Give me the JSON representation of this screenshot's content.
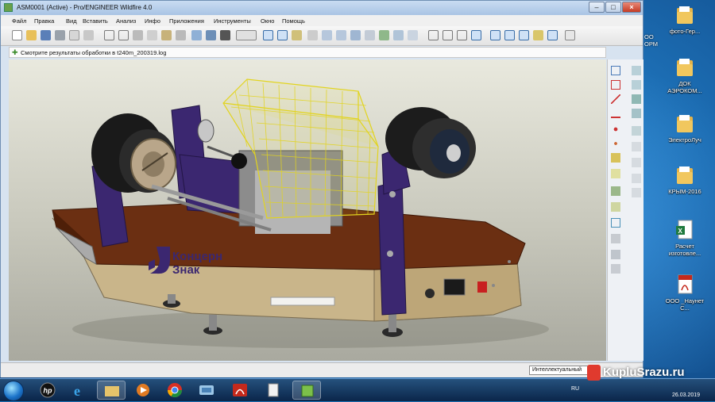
{
  "window": {
    "title": "ASM0001 (Active) - Pro/ENGINEER Wildfire 4.0",
    "minimize": "–",
    "maximize": "□",
    "close": "×"
  },
  "menu": [
    "Файл",
    "Правка",
    "Вид",
    "Вставить",
    "Анализ",
    "Инфо",
    "Приложения",
    "Инструменты",
    "Окно",
    "Помощь"
  ],
  "message": "Смотрите результаты обработки в t240m_200319.log",
  "status": {
    "filter": "Интеллектуальный"
  },
  "model": {
    "brand_line1": "Концерн",
    "brand_line2": "Знак",
    "brand_color": "#3b2770"
  },
  "desktop_icons": [
    {
      "label": "фото-Гер...",
      "icon": "folder-icon"
    },
    {
      "label": "ДОК АЭРОКОМ...",
      "icon": "folder-icon"
    },
    {
      "label": "ЭлектроЛуч",
      "icon": "folder-icon"
    },
    {
      "label": "КРЫМ-2016",
      "icon": "folder-icon"
    },
    {
      "label": "Расчет изготовле...",
      "icon": "excel-icon"
    },
    {
      "label": "ООО _Наунет С...",
      "icon": "pdf-icon"
    }
  ],
  "desktop_partial": {
    "line1": "ОО",
    "line2": "ОРМ"
  },
  "tray": {
    "lang": "RU",
    "date": "26.03.2019"
  },
  "watermark": "KupluSrazu.ru"
}
